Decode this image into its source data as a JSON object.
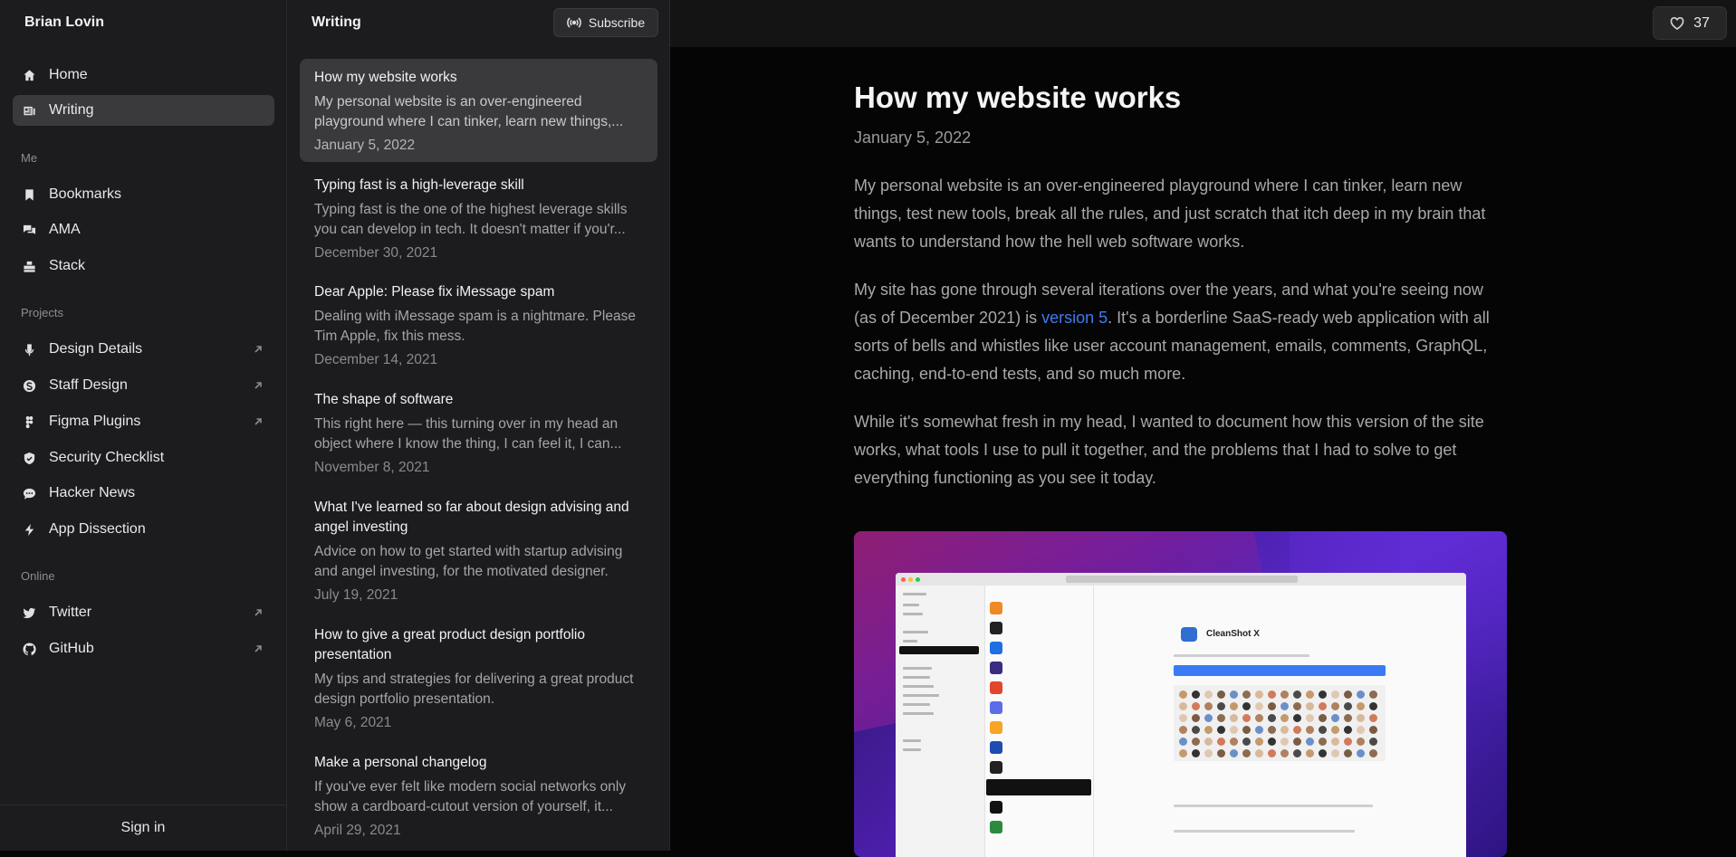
{
  "sidebar": {
    "brand": "Brian Lovin",
    "nav": [
      {
        "label": "Home",
        "icon": "home-icon"
      },
      {
        "label": "Writing",
        "icon": "writing-icon",
        "active": true
      }
    ],
    "me_label": "Me",
    "me": [
      {
        "label": "Bookmarks",
        "icon": "bookmark-icon"
      },
      {
        "label": "AMA",
        "icon": "chat-bubbles-icon"
      },
      {
        "label": "Stack",
        "icon": "stack-icon"
      }
    ],
    "projects_label": "Projects",
    "projects": [
      {
        "label": "Design Details",
        "icon": "microphone-icon",
        "external": true
      },
      {
        "label": "Staff Design",
        "icon": "staff-design-icon",
        "external": true
      },
      {
        "label": "Figma Plugins",
        "icon": "figma-icon",
        "external": true
      },
      {
        "label": "Security Checklist",
        "icon": "shield-icon"
      },
      {
        "label": "Hacker News",
        "icon": "message-icon"
      },
      {
        "label": "App Dissection",
        "icon": "lightning-icon"
      }
    ],
    "online_label": "Online",
    "online": [
      {
        "label": "Twitter",
        "icon": "twitter-icon",
        "external": true
      },
      {
        "label": "GitHub",
        "icon": "github-icon",
        "external": true
      }
    ],
    "sign_in": "Sign in"
  },
  "list": {
    "title": "Writing",
    "subscribe": "Subscribe",
    "posts": [
      {
        "title": "How my website works",
        "excerpt": "My personal website is an over-engineered playground where I can tinker, learn new things,...",
        "date": "January 5, 2022",
        "active": true
      },
      {
        "title": "Typing fast is a high-leverage skill",
        "excerpt": "Typing fast is the one of the highest leverage skills you can develop in tech. It doesn't matter if you'r...",
        "date": "December 30, 2021"
      },
      {
        "title": "Dear Apple: Please fix iMessage spam",
        "excerpt": "Dealing with iMessage spam is a nightmare. Please Tim Apple, fix this mess.",
        "date": "December 14, 2021"
      },
      {
        "title": "The shape of software",
        "excerpt": "This right here — this turning over in my head an object where I know the thing, I can feel it, I can...",
        "date": "November 8, 2021"
      },
      {
        "title": "What I've learned so far about design advising and angel investing",
        "excerpt": "Advice on how to get started with startup advising and angel investing, for the motivated designer.",
        "date": "July 19, 2021"
      },
      {
        "title": "How to give a great product design portfolio presentation",
        "excerpt": "My tips and strategies for delivering a great product design portfolio presentation.",
        "date": "May 6, 2021"
      },
      {
        "title": "Make a personal changelog",
        "excerpt": "If you've ever felt like modern social networks only show a cardboard-cutout version of yourself, it...",
        "date": "April 29, 2021"
      }
    ]
  },
  "topbar": {
    "likes": "37"
  },
  "article": {
    "title": "How my website works",
    "date": "January 5, 2022",
    "p1": "My personal website is an over-engineered playground where I can tinker, learn new things, test new tools, break all the rules, and just scratch that itch deep in my brain that wants to understand how the hell web software works.",
    "p2_before": "My site has gone through several iterations over the years, and what you're seeing now (as of December 2021) is ",
    "p2_link": "version 5",
    "p2_after": ". It's a borderline SaaS-ready web application with all sorts of bells and whistles like user account management, emails, comments, GraphQL, caching, end-to-end tests, and so much more.",
    "p3": "While it's somewhat fresh in my head, I wanted to document how this version of the site works, what tools I use to pull it together, and the problems that I had to solve to get everything functioning as you see it today.",
    "hero_app_name": "CleanShot X"
  },
  "colors": {
    "accent_link": "#3f7bf0",
    "active_row": "#3a3a3c",
    "sidebar_bg": "#1c1c1e",
    "content_bg": "#050505"
  }
}
